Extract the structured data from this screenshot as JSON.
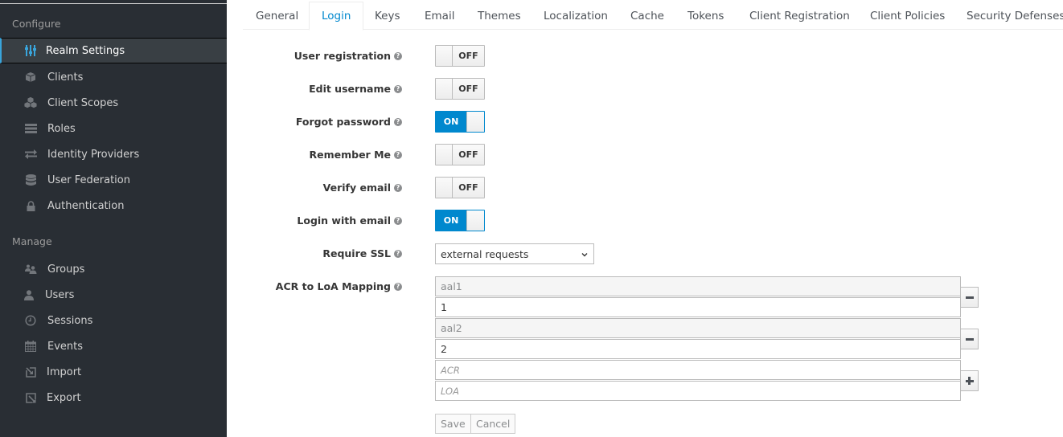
{
  "sidebar": {
    "sections": [
      {
        "title": "Configure",
        "items": [
          {
            "label": "Realm Settings",
            "icon": "sliders-icon",
            "active": true
          },
          {
            "label": "Clients",
            "icon": "cube-icon"
          },
          {
            "label": "Client Scopes",
            "icon": "cubes-icon"
          },
          {
            "label": "Roles",
            "icon": "list-icon"
          },
          {
            "label": "Identity Providers",
            "icon": "exchange-icon"
          },
          {
            "label": "User Federation",
            "icon": "database-icon"
          },
          {
            "label": "Authentication",
            "icon": "lock-icon"
          }
        ]
      },
      {
        "title": "Manage",
        "items": [
          {
            "label": "Groups",
            "icon": "users-icon"
          },
          {
            "label": "Users",
            "icon": "user-icon"
          },
          {
            "label": "Sessions",
            "icon": "clock-icon"
          },
          {
            "label": "Events",
            "icon": "calendar-icon"
          },
          {
            "label": "Import",
            "icon": "import-icon"
          },
          {
            "label": "Export",
            "icon": "export-icon"
          }
        ]
      }
    ]
  },
  "tabs": [
    {
      "label": "General"
    },
    {
      "label": "Login",
      "active": true
    },
    {
      "label": "Keys"
    },
    {
      "label": "Email"
    },
    {
      "label": "Themes"
    },
    {
      "label": "Localization"
    },
    {
      "label": "Cache"
    },
    {
      "label": "Tokens"
    },
    {
      "label": "Client Registration"
    },
    {
      "label": "Client Policies"
    },
    {
      "label": "Security Defenses"
    }
  ],
  "form": {
    "switches": [
      {
        "label": "User registration",
        "state": "OFF"
      },
      {
        "label": "Edit username",
        "state": "OFF"
      },
      {
        "label": "Forgot password",
        "state": "ON"
      },
      {
        "label": "Remember Me",
        "state": "OFF"
      },
      {
        "label": "Verify email",
        "state": "OFF"
      },
      {
        "label": "Login with email",
        "state": "ON"
      }
    ],
    "require_ssl": {
      "label": "Require SSL",
      "value": "external requests"
    },
    "acr_mapping": {
      "label": "ACR to LoA Mapping",
      "entries": [
        {
          "key": "aal1",
          "value": "1"
        },
        {
          "key": "aal2",
          "value": "2"
        }
      ],
      "new_key_placeholder": "ACR",
      "new_value_placeholder": "LOA"
    },
    "save_label": "Save",
    "cancel_label": "Cancel"
  },
  "colors": {
    "accent": "#0088ce",
    "sidebar_bg": "#292e34",
    "active_indicator": "#39a5dc"
  }
}
